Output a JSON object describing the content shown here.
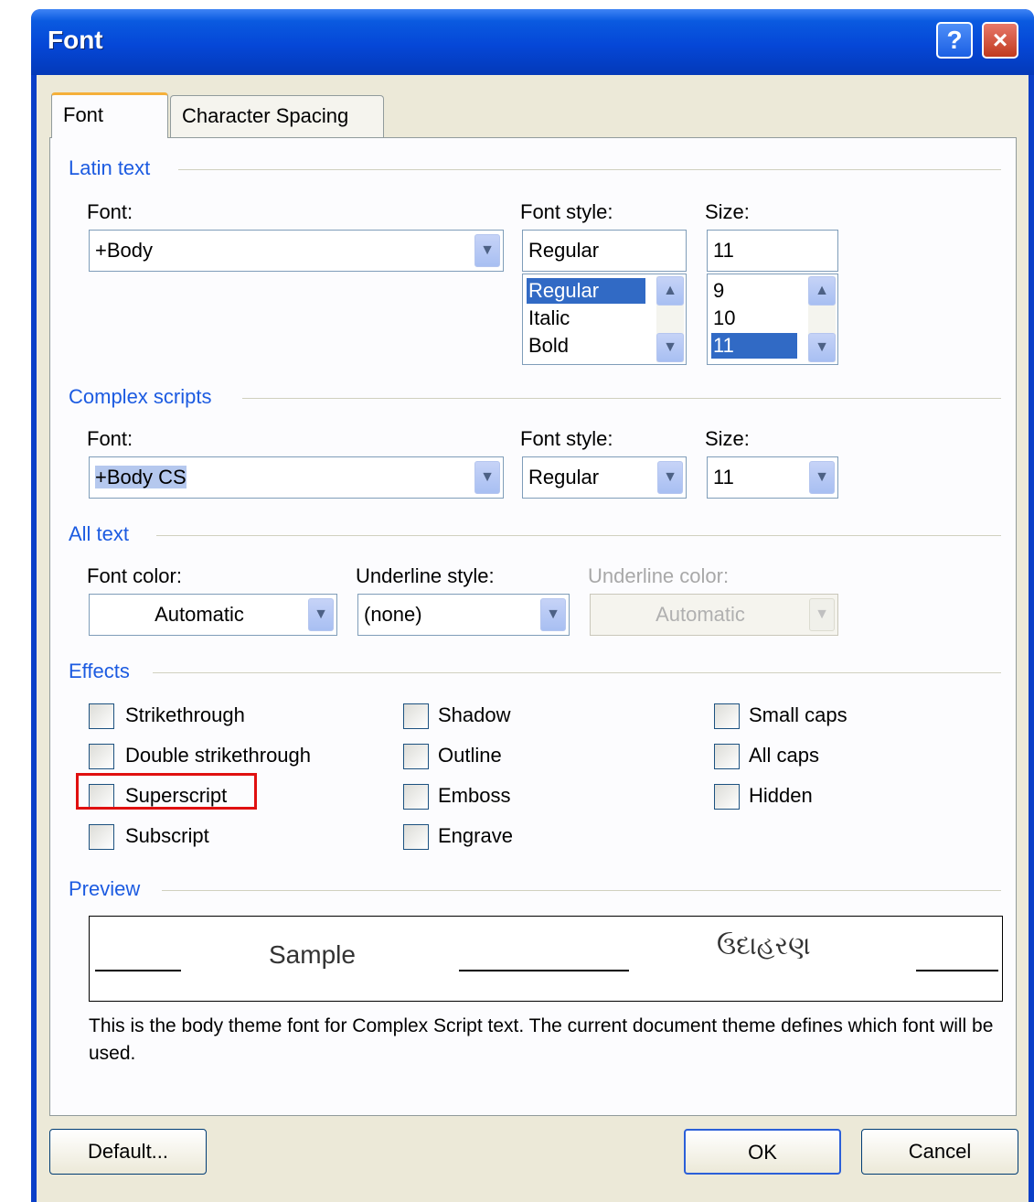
{
  "dialog": {
    "title": "Font",
    "help_icon": "?",
    "close_icon": "×"
  },
  "tabs": [
    {
      "label": "Font",
      "active": true
    },
    {
      "label": "Character Spacing",
      "active": false
    }
  ],
  "latin": {
    "group_label": "Latin text",
    "font_label": "Font:",
    "font_value": "+Body",
    "style_label": "Font style:",
    "style_value": "Regular",
    "style_options": [
      "Regular",
      "Italic",
      "Bold"
    ],
    "style_selected": "Regular",
    "size_label": "Size:",
    "size_value": "11",
    "size_options": [
      "9",
      "10",
      "11"
    ],
    "size_selected": "11"
  },
  "complex": {
    "group_label": "Complex scripts",
    "font_label": "Font:",
    "font_value": "+Body CS",
    "style_label": "Font style:",
    "style_value": "Regular",
    "size_label": "Size:",
    "size_value": "11"
  },
  "all_text": {
    "group_label": "All text",
    "color_label": "Font color:",
    "color_value": "Automatic",
    "underline_label": "Underline style:",
    "underline_value": "(none)",
    "underline_color_label": "Underline color:",
    "underline_color_value": "Automatic"
  },
  "effects": {
    "group_label": "Effects",
    "items": [
      {
        "label": "Strikethrough",
        "checked": false
      },
      {
        "label": "Double strikethrough",
        "checked": false
      },
      {
        "label": "Superscript",
        "checked": false
      },
      {
        "label": "Subscript",
        "checked": false
      },
      {
        "label": "Shadow",
        "checked": false
      },
      {
        "label": "Outline",
        "checked": false
      },
      {
        "label": "Emboss",
        "checked": false
      },
      {
        "label": "Engrave",
        "checked": false
      },
      {
        "label": "Small caps",
        "checked": false
      },
      {
        "label": "All caps",
        "checked": false
      },
      {
        "label": "Hidden",
        "checked": false
      }
    ]
  },
  "preview": {
    "group_label": "Preview",
    "sample_text": "Sample",
    "complex_sample": "ઉદાહરણ",
    "description": "This is the body theme font for Complex Script text. The current document theme defines which font will be used."
  },
  "buttons": {
    "default": "Default...",
    "ok": "OK",
    "cancel": "Cancel"
  },
  "colors": {
    "title_bar": "#0547d7",
    "group_label": "#1c5be1",
    "selection": "#316ac5",
    "highlight_box": "#e01010",
    "dialog_face": "#ece9d8"
  }
}
